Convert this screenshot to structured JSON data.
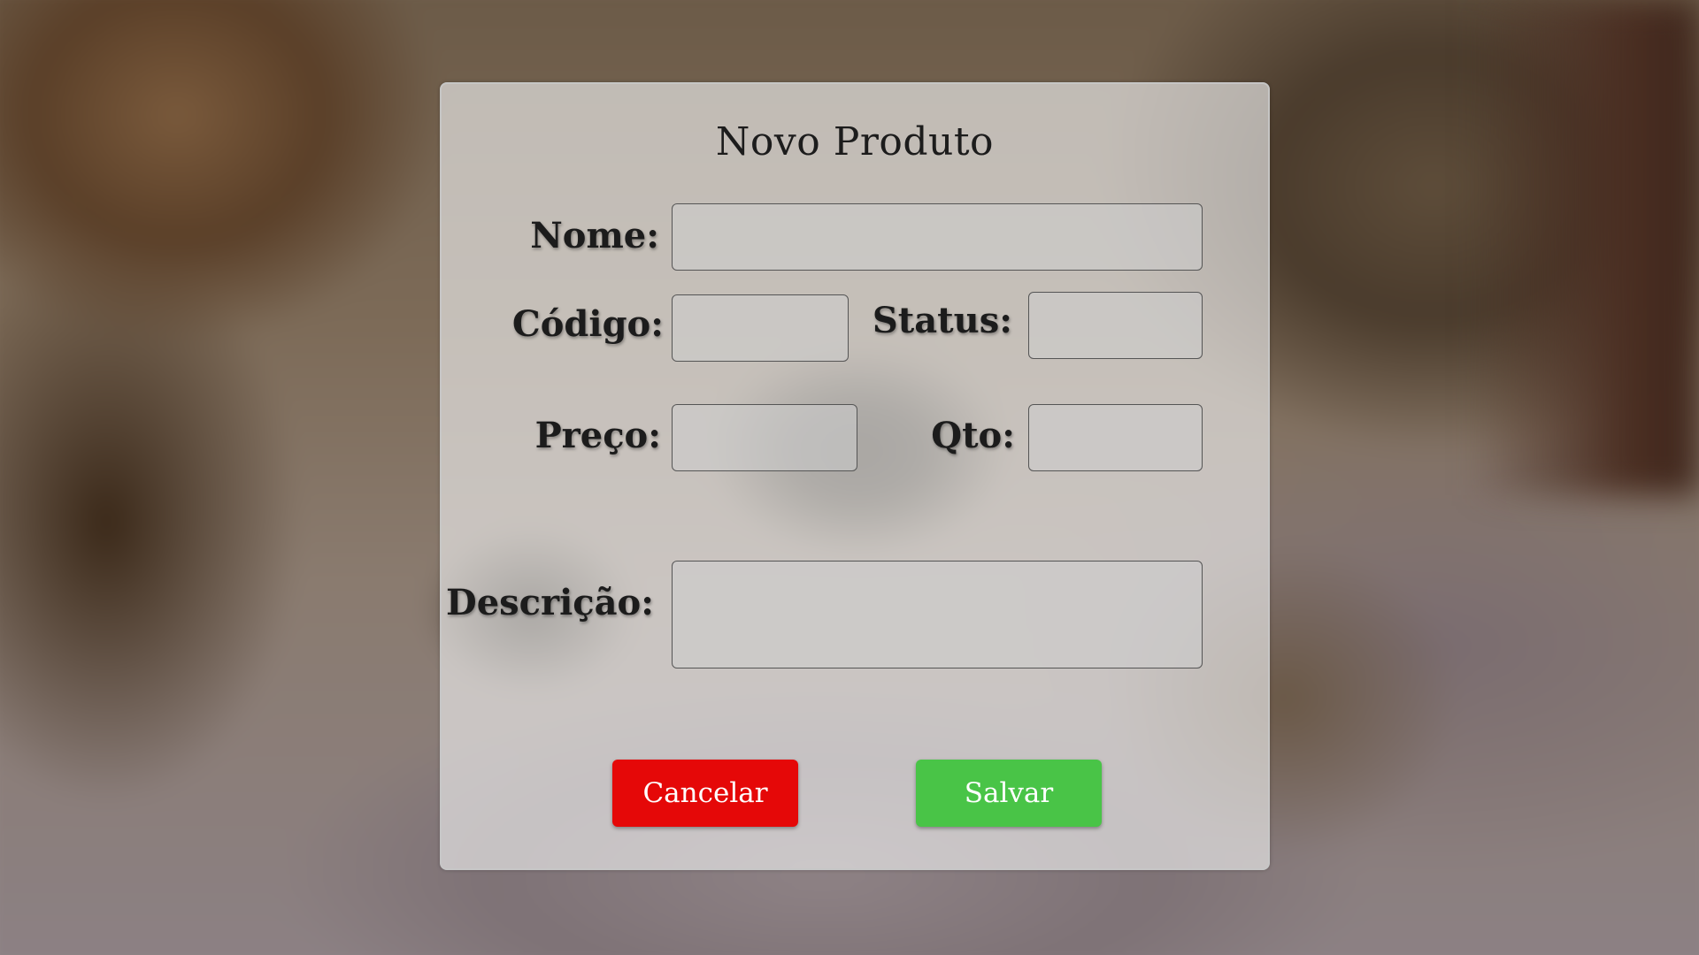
{
  "form": {
    "title": "Novo Produto",
    "fields": {
      "nome": {
        "label": "Nome:",
        "value": ""
      },
      "codigo": {
        "label": "Código:",
        "value": ""
      },
      "status": {
        "label": "Status:",
        "value": ""
      },
      "preco": {
        "label": "Preço:",
        "value": ""
      },
      "qto": {
        "label": "Qto:",
        "value": ""
      },
      "descricao": {
        "label": "Descrição:",
        "value": ""
      }
    },
    "buttons": {
      "cancel": {
        "label": "Cancelar",
        "color": "#e50808"
      },
      "save": {
        "label": "Salvar",
        "color": "#49c447"
      }
    }
  }
}
